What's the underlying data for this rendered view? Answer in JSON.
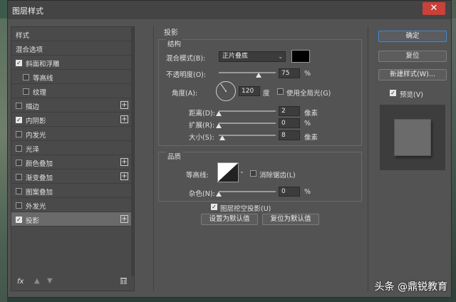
{
  "window": {
    "title": "图层样式",
    "close_label": "✕"
  },
  "left_panel": {
    "items": [
      {
        "label": "样式",
        "checkbox": false,
        "checked": false,
        "plus": false,
        "indent": false,
        "selected": false
      },
      {
        "label": "混合选项",
        "checkbox": false,
        "checked": false,
        "plus": false,
        "indent": false,
        "selected": false
      },
      {
        "label": "斜面和浮雕",
        "checkbox": true,
        "checked": true,
        "plus": false,
        "indent": false,
        "selected": false
      },
      {
        "label": "等高线",
        "checkbox": true,
        "checked": false,
        "plus": false,
        "indent": true,
        "selected": false
      },
      {
        "label": "纹理",
        "checkbox": true,
        "checked": false,
        "plus": false,
        "indent": true,
        "selected": false
      },
      {
        "label": "描边",
        "checkbox": true,
        "checked": false,
        "plus": true,
        "indent": false,
        "selected": false
      },
      {
        "label": "内阴影",
        "checkbox": true,
        "checked": true,
        "plus": true,
        "indent": false,
        "selected": false
      },
      {
        "label": "内发光",
        "checkbox": true,
        "checked": false,
        "plus": false,
        "indent": false,
        "selected": false
      },
      {
        "label": "光泽",
        "checkbox": true,
        "checked": false,
        "plus": false,
        "indent": false,
        "selected": false
      },
      {
        "label": "颜色叠加",
        "checkbox": true,
        "checked": false,
        "plus": true,
        "indent": false,
        "selected": false
      },
      {
        "label": "渐变叠加",
        "checkbox": true,
        "checked": false,
        "plus": true,
        "indent": false,
        "selected": false
      },
      {
        "label": "图案叠加",
        "checkbox": true,
        "checked": false,
        "plus": false,
        "indent": false,
        "selected": false
      },
      {
        "label": "外发光",
        "checkbox": true,
        "checked": false,
        "plus": false,
        "indent": false,
        "selected": false
      },
      {
        "label": "投影",
        "checkbox": true,
        "checked": true,
        "plus": true,
        "indent": false,
        "selected": true
      }
    ],
    "fx_label": "fx",
    "up_icon": "arrow-up-icon",
    "down_icon": "arrow-down-icon",
    "delete_icon": "trash-icon"
  },
  "drop_shadow": {
    "section_title": "投影",
    "structure": {
      "title": "结构",
      "blend_mode_label": "混合模式(B):",
      "blend_mode_value": "正片叠底",
      "shadow_color": "#000000",
      "opacity_label": "不透明度(O):",
      "opacity_value": "75",
      "opacity_fraction": 0.75,
      "angle_label": "角度(A):",
      "angle_value": "120",
      "angle_unit": "度",
      "global_light_label": "使用全局光(G)",
      "global_light_checked": false,
      "distance_label": "距离(D):",
      "distance_value": "2",
      "distance_unit": "像素",
      "spread_label": "扩展(R):",
      "spread_value": "0",
      "spread_unit": "%",
      "size_label": "大小(S):",
      "size_value": "8",
      "size_unit": "像素",
      "percent_unit": "%"
    },
    "quality": {
      "title": "品质",
      "contour_label": "等高线:",
      "antialias_label": "消除锯齿(L)",
      "antialias_checked": false,
      "noise_label": "杂色(N):",
      "noise_value": "0",
      "noise_unit": "%"
    },
    "knockout_label": "图层挖空投影(U)",
    "knockout_checked": true,
    "make_default_label": "设置为默认值",
    "reset_default_label": "复位为默认值"
  },
  "buttons": {
    "ok": "确定",
    "reset": "复位",
    "new_style": "新建样式(W)...",
    "preview_label": "预览(V)",
    "preview_checked": true
  },
  "watermark": "头条 @鼎锐教育"
}
